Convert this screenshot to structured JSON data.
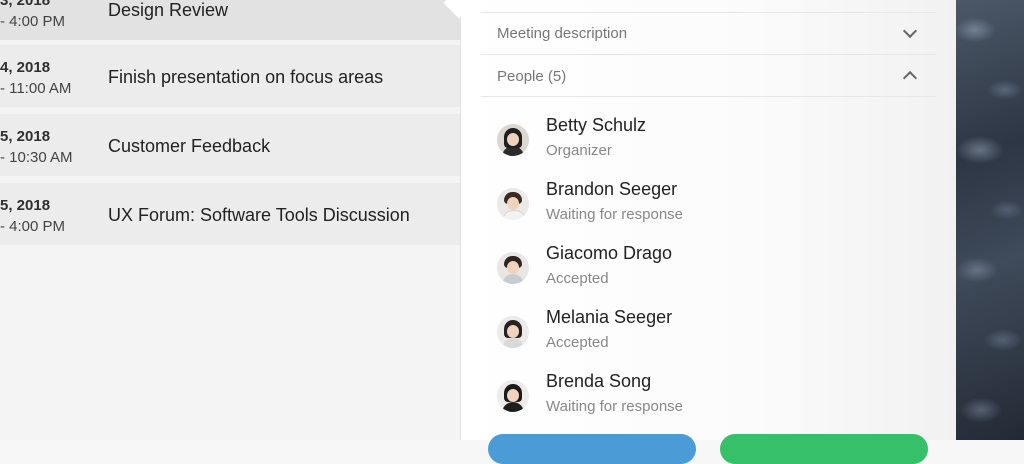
{
  "events": [
    {
      "date": "3, 2018",
      "time": "- 4:00 PM",
      "title": "Design Review"
    },
    {
      "date": "4, 2018",
      "time": "- 11:00 AM",
      "title": "Finish presentation on focus areas"
    },
    {
      "date": "5, 2018",
      "time": "- 10:30 AM",
      "title": "Customer Feedback"
    },
    {
      "date": "5, 2018",
      "time": "- 4:00 PM",
      "title": "UX Forum: Software Tools Discussion"
    }
  ],
  "details": {
    "description_label": "Meeting description",
    "people_label": "People (5)"
  },
  "people": [
    {
      "name": "Betty Schulz",
      "status": "Organizer"
    },
    {
      "name": "Brandon Seeger",
      "status": "Waiting for response"
    },
    {
      "name": "Giacomo Drago",
      "status": "Accepted"
    },
    {
      "name": "Melania Seeger",
      "status": "Accepted"
    },
    {
      "name": "Brenda Song",
      "status": "Waiting for response"
    }
  ],
  "colors": {
    "button_blue": "#4b9bd6",
    "button_green": "#36c06a"
  },
  "icons": {
    "description_toggle": "chevron-down-icon",
    "people_toggle": "chevron-up-icon"
  }
}
